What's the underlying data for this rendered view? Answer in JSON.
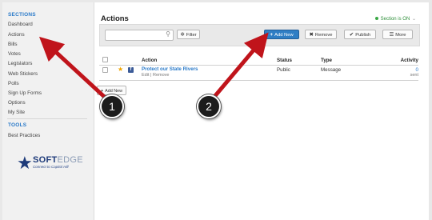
{
  "sidebar": {
    "sections_title": "SECTIONS",
    "items": [
      {
        "label": "Dashboard"
      },
      {
        "label": "Actions"
      },
      {
        "label": "Bills"
      },
      {
        "label": "Votes"
      },
      {
        "label": "Legislators"
      },
      {
        "label": "Web Stickers"
      },
      {
        "label": "Polls"
      },
      {
        "label": "Sign Up Forms"
      },
      {
        "label": "Options"
      },
      {
        "label": "My Site"
      }
    ],
    "tools_title": "TOOLS",
    "tools": [
      {
        "label": "Best Practices"
      }
    ],
    "logo": {
      "brand_a": "SOFT",
      "brand_b": "EDGE",
      "tagline": "Connect to Capitol Hill"
    }
  },
  "main": {
    "title": "Actions",
    "status_text": "Section is ON",
    "status_caret": "⌄",
    "toolbar": {
      "search_placeholder": "",
      "filter_label": "Filter",
      "add_new_label": "Add New",
      "remove_label": "Remove",
      "publish_label": "Publish",
      "more_label": "More"
    },
    "columns": {
      "action": "Action",
      "status": "Status",
      "type": "Type",
      "activity": "Activity"
    },
    "rows": [
      {
        "title": "Protect our State Rivers",
        "edit": "Edit",
        "divider": "|",
        "remove": "Remove",
        "status": "Public",
        "type": "Message",
        "count": "0",
        "count_label": "sent"
      }
    ],
    "add_new_small": "Add New"
  },
  "callouts": [
    {
      "label": "1"
    },
    {
      "label": "2"
    }
  ],
  "colors": {
    "accent": "#2a7ac9",
    "primary_button": "#2f7ec4",
    "status_on": "#3aa845",
    "arrow": "#c0141b"
  }
}
